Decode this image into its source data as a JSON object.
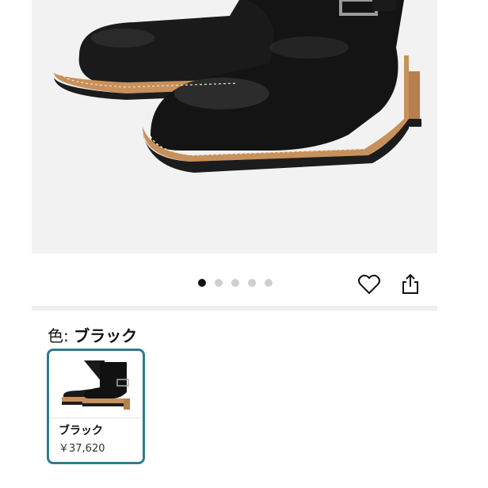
{
  "gallery": {
    "image_alt": "Black leather engineer boots",
    "dot_count": 5,
    "active_index": 0
  },
  "actions": {
    "favorite_icon": "heart-icon",
    "share_icon": "share-icon"
  },
  "variant": {
    "label": "色: ",
    "selected": "ブラック",
    "options": [
      {
        "name": "ブラック",
        "price": "￥37,620"
      }
    ],
    "accent_color": "#2f7d8c"
  }
}
